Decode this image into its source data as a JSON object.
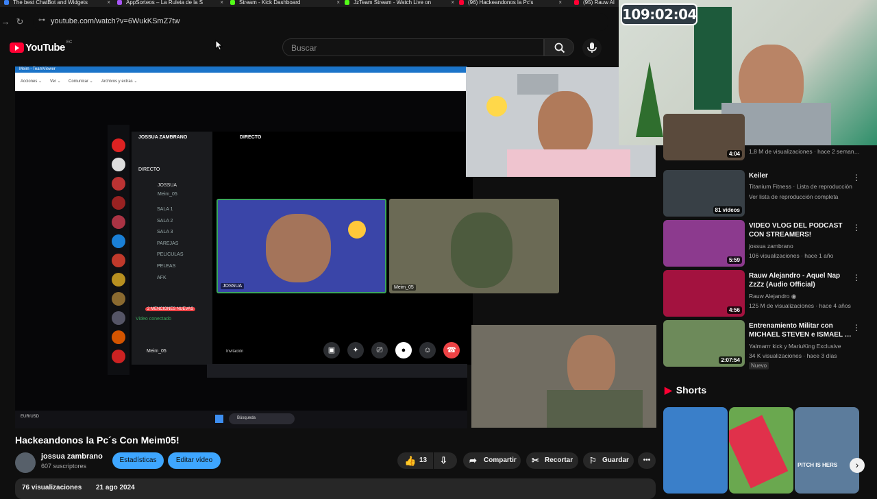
{
  "browser": {
    "tabs": [
      {
        "label": "The best ChatBot and Widgets",
        "color": "#3b82f6"
      },
      {
        "label": "AppSorteos – La Ruleta de la S",
        "color": "#a855f7"
      },
      {
        "label": "Stream - Kick Dashboard",
        "color": "#53fc18"
      },
      {
        "label": "JzTeam Stream - Watch Live on",
        "color": "#53fc18"
      },
      {
        "label": "(96) Hackeandonos la Pc's",
        "color": "#ff0033"
      },
      {
        "label": "(95) Rauw Al",
        "color": "#ff0033"
      }
    ],
    "url": "youtube.com/watch?v=6WukKSmZ7tw"
  },
  "youtube": {
    "logo": "YouTube",
    "country": "EC",
    "search_placeholder": "Buscar"
  },
  "overlay": {
    "timer": "109:02:04"
  },
  "screen_share": {
    "teamviewer_title": "Meim - TeamViewer",
    "menu": [
      "Acciones ⌄",
      "Ver ⌄",
      "Comunicar ⌄",
      "Archivos y extras ⌄"
    ],
    "discord": {
      "server_title": "JOSSUA ZAMBRANO",
      "channels": [
        "DIRECTO",
        "JOSSUA",
        "Meim_05",
        "SALA 1",
        "SALA 2",
        "SALA 3",
        "PAREJAS",
        "PELICULAS",
        "PELEAS",
        "AFK"
      ],
      "stage_title": "DIRECTO",
      "cam_names": [
        "JOSSUA",
        "Meim_05"
      ],
      "user": "Meim_05",
      "invite": "Invitación",
      "mentions": "2 MENCIONES NUEVAS",
      "video_status": "Video conectado"
    },
    "taskbar_search": "Búsqueda",
    "ticker": "EUR/USD"
  },
  "video": {
    "title": "Hackeandonos la Pc´s Con Meim05!",
    "channel": "jossua zambrano",
    "subscribers": "607 suscriptores",
    "stats_button": "Estadísticas",
    "edit_button": "Editar vídeo",
    "likes": "13",
    "share": "Compartir",
    "clip": "Recortar",
    "save": "Guardar",
    "views": "76 visualizaciones",
    "date": "21 ago 2024"
  },
  "sidebar": {
    "items": [
      {
        "title": "",
        "meta1": "1,8 M de visualizaciones · hace 2 seman…",
        "meta2": "",
        "duration": "4:04",
        "thumb": "#5a4a3c"
      },
      {
        "title": "Keiler",
        "meta1": "Titanium Fitness · Lista de reproducción",
        "meta2": "Ver lista de reproducción completa",
        "duration": "81 vídeos",
        "thumb": "#384046"
      },
      {
        "title": "VIDEO VLOG DEL PODCAST CON STREAMERS!",
        "meta1": "jossua zambrano",
        "meta2": "106 visualizaciones · hace 1 año",
        "duration": "5:59",
        "thumb": "#8c3a8e"
      },
      {
        "title": "Rauw Alejandro - Aquel Nap ZzZz (Audio Official)",
        "meta1": "Rauw Alejandro ◉",
        "meta2": "125 M de visualizaciones · hace 4 años",
        "duration": "4:56",
        "thumb": "#a3123f"
      },
      {
        "title": "Entrenamiento Militar con MICHAEL STEVEN e ISMAEL …",
        "meta1": "Yalmarrr kick y MariuKing Exclusive",
        "meta2": "34 K visualizaciones · hace 3 días",
        "duration": "2:07:54",
        "thumb": "#6d8a5a",
        "badge": "Nuevo"
      }
    ],
    "shorts_label": "Shorts",
    "shorts_texts": [
      "PITCH IS HERS"
    ]
  }
}
